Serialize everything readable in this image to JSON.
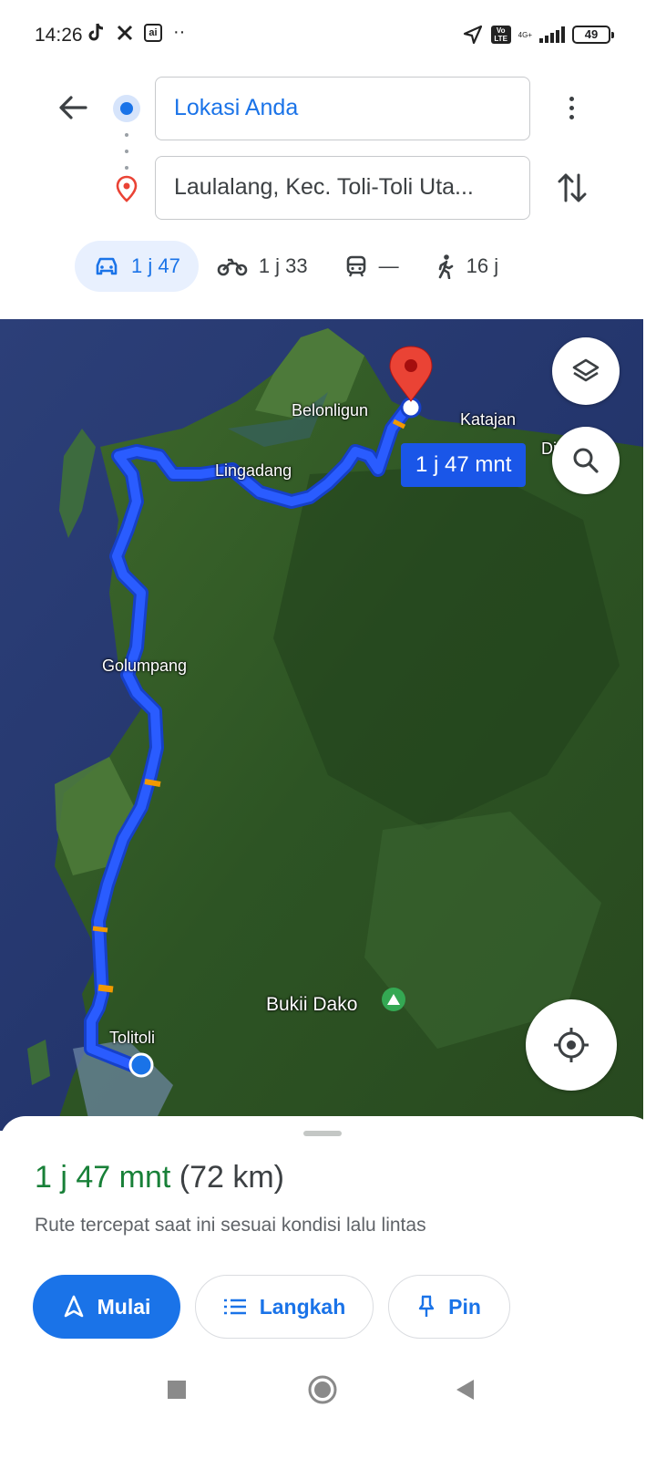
{
  "status_bar": {
    "time": "14:26",
    "left_icons": [
      "tiktok-icon",
      "x-icon",
      "ai-icon",
      "more-dots"
    ],
    "ai_glyph": "ai",
    "more_glyph": "··",
    "volte_top": "Vo",
    "volte_bottom": "LTE",
    "network": "4G+",
    "battery": "49"
  },
  "directions": {
    "origin": "Lokasi Anda",
    "destination": "Laulalang, Kec. Toli-Toli Uta...",
    "modes": [
      {
        "icon": "car-icon",
        "label": "1 j 47",
        "active": true
      },
      {
        "icon": "motorcycle-icon",
        "label": "1 j 33",
        "active": false
      },
      {
        "icon": "transit-icon",
        "label": "—",
        "active": false
      },
      {
        "icon": "walk-icon",
        "label": "16 j",
        "active": false
      }
    ]
  },
  "map": {
    "type": "satellite",
    "places": {
      "belonligun": "Belonligun",
      "katajan": "Katajan",
      "di": "Di",
      "lingadang": "Lingadang",
      "golumpang": "Golumpang",
      "bukit_dako": "Bukii Dako",
      "tolitoli": "Tolitoli"
    },
    "eta_bubble": "1 j 47 mnt",
    "route_color": "#1f4ff2",
    "congestion_color": "#f29900"
  },
  "sheet": {
    "duration": "1 j 47 mnt",
    "distance": "(72 km)",
    "description": "Rute tercepat saat ini sesuai kondisi lalu lintas",
    "start_label": "Mulai",
    "steps_label": "Langkah",
    "pin_label": "Pin"
  },
  "colors": {
    "accent": "#1a73e8",
    "duration_green": "#188038",
    "active_mode_bg": "#e8f0fe",
    "destination_red": "#ea4335"
  }
}
